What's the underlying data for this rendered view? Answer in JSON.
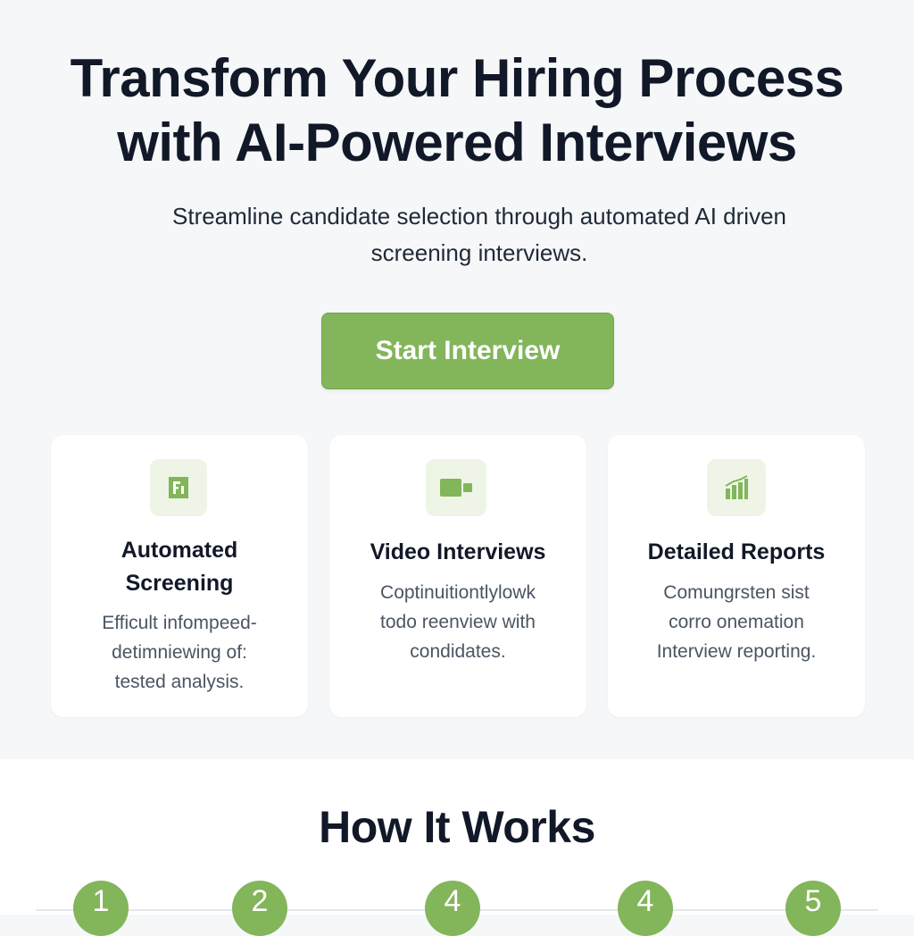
{
  "hero": {
    "headline_line1": "Transform Your Hiring Process",
    "headline_line2": "with AI-Powered Interviews",
    "subtitle_line1": "Streamline candidate selection through automated AI driven",
    "subtitle_line2": "screening interviews.",
    "cta_label": "Start Interview"
  },
  "features": [
    {
      "icon": "document-icon",
      "title_line1": "Automated",
      "title_line2": "Screening",
      "desc_lines": [
        "Efficult infompeed-",
        "detimniewing of:",
        "tested analysis."
      ]
    },
    {
      "icon": "video-camera-icon",
      "title_line1": "Video Interviews",
      "desc_lines": [
        "Coptinuitiontlylowk",
        "todo reenview with",
        "condidates."
      ]
    },
    {
      "icon": "bar-chart-icon",
      "title_line1": "Detailed Reports",
      "desc_lines": [
        "Comungrsten sist",
        "corro onemation",
        "Interview reporting."
      ]
    }
  ],
  "how_it_works": {
    "title": "How It Works",
    "steps": [
      "1",
      "2",
      "4",
      "4",
      "5"
    ]
  },
  "colors": {
    "accent": "#83b55a",
    "icon_bg": "#eef5e6",
    "page_bg": "#f6f7f9",
    "card_bg": "#ffffff",
    "text_dark": "#111827",
    "text_muted": "#4b5563"
  }
}
